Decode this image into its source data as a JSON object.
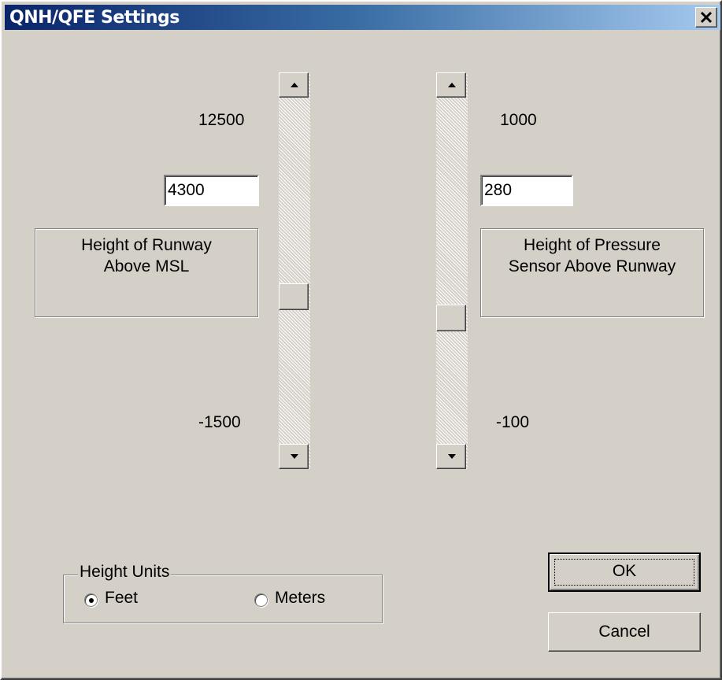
{
  "window": {
    "title": "QNH/QFE Settings"
  },
  "runway_slider": {
    "max_label": "12500",
    "min_label": "-1500",
    "max": 12500,
    "min": -1500,
    "value_text": "4300",
    "caption_line1": "Height of Runway",
    "caption_line2": "Above MSL"
  },
  "sensor_slider": {
    "max_label": "1000",
    "min_label": "-100",
    "max": 1000,
    "min": -100,
    "value_text": "280",
    "caption_line1": "Height of Pressure",
    "caption_line2": "Sensor Above Runway"
  },
  "units": {
    "legend": "Height Units",
    "feet_label": "Feet",
    "meters_label": "Meters",
    "selected": "Feet"
  },
  "buttons": {
    "ok": "OK",
    "cancel": "Cancel"
  },
  "icons": {
    "close": "close-icon",
    "scroll_up": "up-arrow-icon",
    "scroll_down": "down-arrow-icon"
  }
}
